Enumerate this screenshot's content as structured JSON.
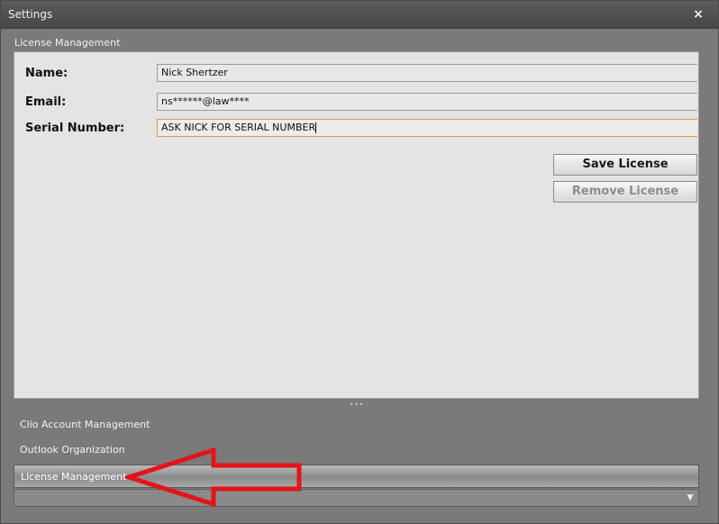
{
  "window": {
    "title": "Settings",
    "close_glyph": "×"
  },
  "section": {
    "header": "License Management"
  },
  "form": {
    "name_label": "Name:",
    "name_value": "Nick Shertzer",
    "email_label": "Email:",
    "email_value": "ns******@law****",
    "serial_label": "Serial Number:",
    "serial_value": "ASK NICK FOR SERIAL NUMBER"
  },
  "buttons": {
    "save_label": "Save License",
    "remove_label": "Remove License"
  },
  "splitter": {
    "grip_glyph": "•••"
  },
  "nav": {
    "items": [
      {
        "label": "Clio Account Management"
      },
      {
        "label": "Outlook Organization"
      },
      {
        "label": "License Management"
      }
    ]
  },
  "bottom_bar": {
    "dropdown_glyph": "▼"
  },
  "colors": {
    "window_bg": "#7a7a7a",
    "panel_bg": "#e4e4e4",
    "focus_border": "#e39a3c",
    "annotation_arrow": "#e2141a"
  },
  "icons": {
    "close": "close-icon",
    "dropdown": "chevron-down-icon",
    "annotation": "red-arrow-annotation"
  }
}
